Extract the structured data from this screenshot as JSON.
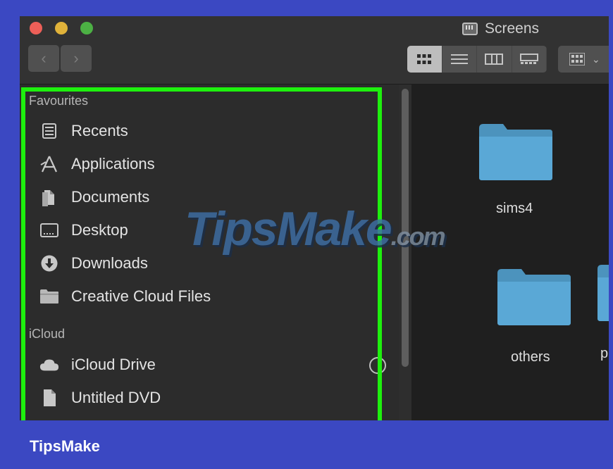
{
  "window": {
    "title": "Screens",
    "title_icon": "display-folder-icon",
    "traffic_lights": {
      "close": "#ed5f58",
      "minimize": "#e0b23a",
      "maximize": "#4cb044"
    }
  },
  "toolbar": {
    "back_glyph": "‹",
    "forward_glyph": "›",
    "views": [
      {
        "name": "icon-view",
        "active": true
      },
      {
        "name": "list-view",
        "active": false
      },
      {
        "name": "column-view",
        "active": false
      },
      {
        "name": "gallery-view",
        "active": false
      }
    ],
    "group_chevron": "⌄"
  },
  "sidebar": {
    "favourites_label": "Favourites",
    "favourites": [
      {
        "label": "Recents",
        "icon": "recents-icon"
      },
      {
        "label": "Applications",
        "icon": "applications-icon"
      },
      {
        "label": "Documents",
        "icon": "documents-icon"
      },
      {
        "label": "Desktop",
        "icon": "desktop-icon"
      },
      {
        "label": "Downloads",
        "icon": "downloads-icon"
      },
      {
        "label": "Creative Cloud Files",
        "icon": "folder-icon"
      }
    ],
    "icloud_label": "iCloud",
    "icloud": [
      {
        "label": "iCloud Drive",
        "icon": "cloud-icon"
      },
      {
        "label": "Untitled DVD",
        "icon": "document-icon"
      }
    ],
    "highlight_color": "#1ef00e"
  },
  "files": [
    {
      "name": "sims4"
    },
    {
      "name": "others"
    },
    {
      "name": "p"
    }
  ],
  "watermark": {
    "main": "TipsMake",
    "suffix": ".com"
  },
  "caption": "TipsMake",
  "colors": {
    "frame": "#3b48c2",
    "folder": "#5aa8d6"
  }
}
